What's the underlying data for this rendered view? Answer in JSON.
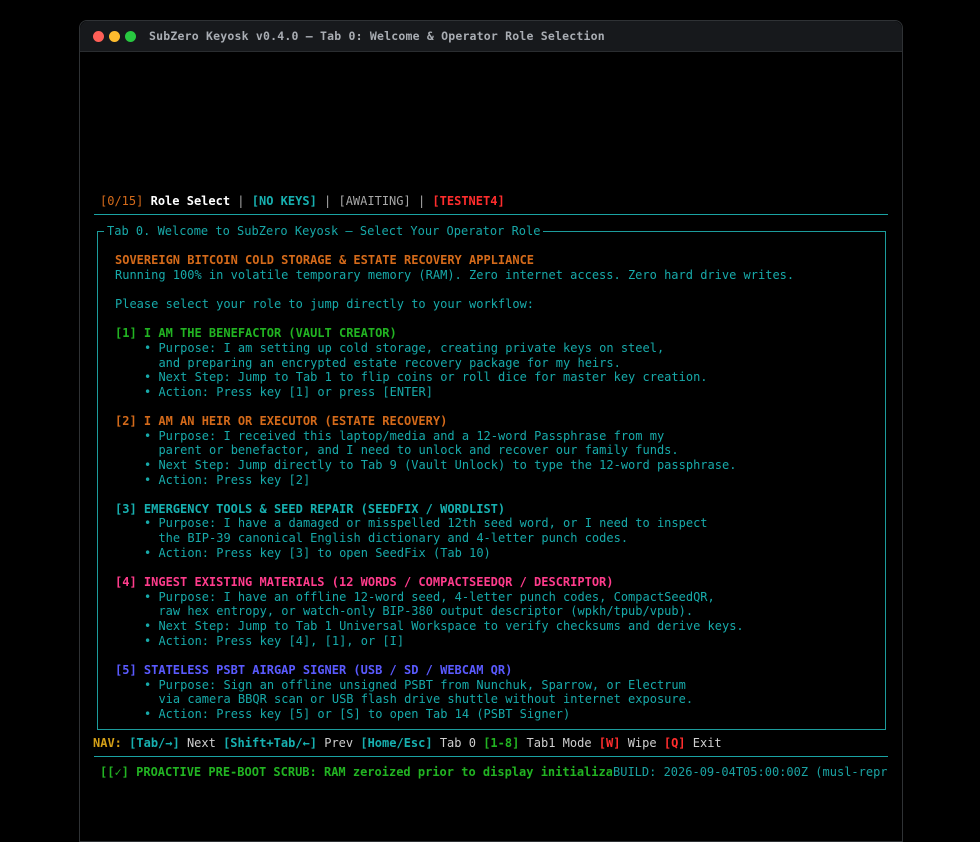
{
  "window": {
    "title": "SubZero Keyosk v0.4.0 — Tab 0: Welcome & Operator Role Selection"
  },
  "status": {
    "counter": "[0/15]",
    "mode": "Role Select",
    "sep": " | ",
    "keys": "[NO KEYS]",
    "state": "[AWAITING]",
    "network": "[TESTNET4]"
  },
  "panel": {
    "title": "Tab 0. Welcome to SubZero Keyosk — Select Your Operator Role",
    "heading": "SOVEREIGN BITCOIN COLD STORAGE & ESTATE RECOVERY APPLIANCE",
    "subheading": "Running 100% in volatile temporary memory (RAM). Zero internet access. Zero hard drive writes.",
    "prompt": "Please select your role to jump directly to your workflow:",
    "roles": [
      {
        "title": "[1] I AM THE BENEFACTOR (VAULT CREATOR)",
        "lines": [
          "• Purpose: I am setting up cold storage, creating private keys on steel,",
          "  and preparing an encrypted estate recovery package for my heirs.",
          "• Next Step: Jump to Tab 1 to flip coins or roll dice for master key creation.",
          "• Action: Press key [1] or press [ENTER]"
        ]
      },
      {
        "title": "[2] I AM AN HEIR OR EXECUTOR (ESTATE RECOVERY)",
        "lines": [
          "• Purpose: I received this laptop/media and a 12-word Passphrase from my",
          "  parent or benefactor, and I need to unlock and recover our family funds.",
          "• Next Step: Jump directly to Tab 9 (Vault Unlock) to type the 12-word passphrase.",
          "• Action: Press key [2]"
        ]
      },
      {
        "title": "[3] EMERGENCY TOOLS & SEED REPAIR (SEEDFIX / WORDLIST)",
        "lines": [
          "• Purpose: I have a damaged or misspelled 12th seed word, or I need to inspect",
          "  the BIP-39 canonical English dictionary and 4-letter punch codes.",
          "• Action: Press key [3] to open SeedFix (Tab 10)"
        ]
      },
      {
        "title": "[4] INGEST EXISTING MATERIALS (12 WORDS / COMPACTSEEDQR / DESCRIPTOR)",
        "lines": [
          "• Purpose: I have an offline 12-word seed, 4-letter punch codes, CompactSeedQR,",
          "  raw hex entropy, or watch-only BIP-380 output descriptor (wpkh/tpub/vpub).",
          "• Next Step: Jump to Tab 1 Universal Workspace to verify checksums and derive keys.",
          "• Action: Press key [4], [1], or [I]"
        ]
      },
      {
        "title": "[5] STATELESS PSBT AIRGAP SIGNER (USB / SD / WEBCAM QR)",
        "lines": [
          "• Purpose: Sign an offline unsigned PSBT from Nunchuk, Sparrow, or Electrum",
          "  via camera BBQR scan or USB flash drive shuttle without internet exposure.",
          "• Action: Press key [5] or [S] to open Tab 14 (PSBT Signer)"
        ]
      }
    ]
  },
  "nav": {
    "label": "NAV:",
    "k1": "[Tab/→]",
    "t1": " Next ",
    "k2": "[Shift+Tab/←]",
    "t2": " Prev ",
    "k3": "[Home/Esc]",
    "t3": " Tab 0 ",
    "k4": "[1-8]",
    "t4": " Tab1 Mode ",
    "k5": "[W]",
    "t5": " Wipe ",
    "k6": "[Q]",
    "t6": " Exit"
  },
  "footer": {
    "left": "[[✓] PROACTIVE PRE-BOOT SCRUB: RAM zeroized prior to display initializa",
    "right": "BUILD: 2026-09-04T05:00:00Z (musl-repr"
  },
  "colors": {
    "role1": "#22b422",
    "role2": "#d46a1a",
    "role3": "#17b0b0",
    "role4": "#ff3c8c",
    "role5": "#5a5aff",
    "border": "#1c9c9c"
  }
}
